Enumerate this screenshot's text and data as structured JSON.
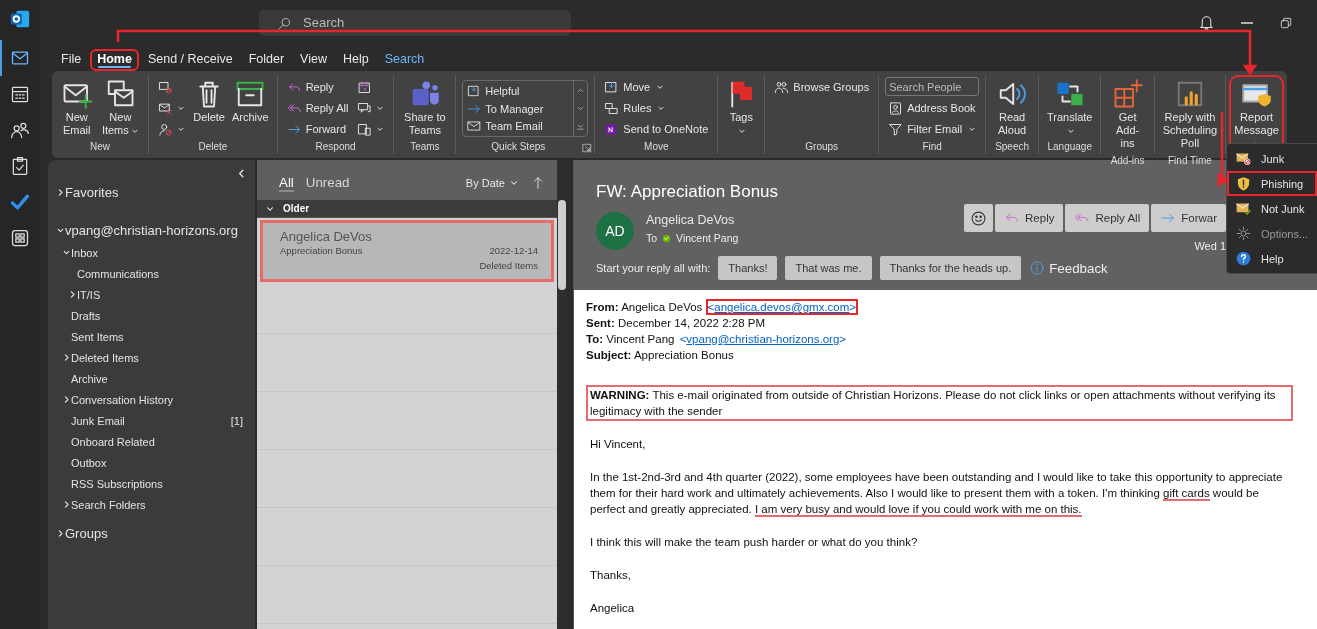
{
  "app_bar": {
    "items": [
      {
        "selected": true
      },
      {
        "selected": false
      },
      {
        "selected": false
      },
      {
        "selected": false
      },
      {
        "selected": false
      },
      {
        "selected": false
      }
    ]
  },
  "search": {
    "placeholder": "Search"
  },
  "menu_tabs": [
    {
      "label": "File",
      "kind": "standard",
      "selected": false,
      "highlighted": false
    },
    {
      "label": "Home",
      "kind": "standard",
      "selected": true,
      "highlighted": true
    },
    {
      "label": "Send / Receive",
      "kind": "standard",
      "selected": false,
      "highlighted": false
    },
    {
      "label": "Folder",
      "kind": "standard",
      "selected": false,
      "highlighted": false
    },
    {
      "label": "View",
      "kind": "standard",
      "selected": false,
      "highlighted": false
    },
    {
      "label": "Help",
      "kind": "standard",
      "selected": false,
      "highlighted": false
    },
    {
      "label": "Search",
      "kind": "contextual",
      "selected": false,
      "highlighted": false
    }
  ],
  "ribbon": {
    "groups": [
      {
        "label": "New",
        "highlighted": false,
        "columns": [
          [
            {
              "kind": "large",
              "label": "New Email"
            }
          ],
          [
            {
              "kind": "large",
              "label": "New Items",
              "dropdown": true
            }
          ]
        ]
      },
      {
        "label": "Delete",
        "highlighted": false,
        "columns": [
          [
            {
              "kind": "icon"
            },
            {
              "kind": "icon",
              "dropdown": true
            },
            {
              "kind": "icon",
              "dropdown": true
            }
          ],
          [
            {
              "kind": "large",
              "label": "Delete"
            }
          ],
          [
            {
              "kind": "large",
              "label": "Archive"
            }
          ]
        ]
      },
      {
        "label": "Respond",
        "highlighted": false,
        "columns": [
          [
            {
              "kind": "small",
              "label": "Reply"
            },
            {
              "kind": "small",
              "label": "Reply All"
            },
            {
              "kind": "small",
              "label": "Forward"
            }
          ],
          [
            {
              "kind": "icon"
            },
            {
              "kind": "icon",
              "dropdown": true
            },
            {
              "kind": "icon",
              "dropdown": true
            }
          ]
        ]
      },
      {
        "label": "Teams",
        "highlighted": false,
        "columns": [
          [
            {
              "kind": "large",
              "label": "Share to Teams"
            }
          ]
        ]
      },
      {
        "label": "Quick Steps",
        "highlighted": false,
        "launcher": true,
        "columns": [
          [
            {
              "kind": "gallery",
              "items": [
                "Helpful",
                "To Manager",
                "Team Email"
              ]
            }
          ]
        ]
      },
      {
        "label": "Move",
        "highlighted": false,
        "columns": [
          [
            {
              "kind": "small",
              "label": "Move",
              "dropdown": true
            },
            {
              "kind": "small",
              "label": "Rules",
              "dropdown": true
            },
            {
              "kind": "small",
              "label": "Send to OneNote"
            }
          ]
        ]
      },
      {
        "highlighted": false,
        "columns": [
          [
            {
              "kind": "large",
              "label": "Tags",
              "dropdown": true
            }
          ]
        ]
      },
      {
        "label": "Groups",
        "highlighted": false,
        "columns": [
          [
            {
              "kind": "small",
              "label": "Browse Groups"
            }
          ]
        ]
      },
      {
        "label": "Find",
        "highlighted": false,
        "columns": [
          [
            {
              "kind": "field",
              "placeholder": "Search People"
            },
            {
              "kind": "small",
              "label": "Address Book"
            },
            {
              "kind": "small",
              "label": "Filter Email",
              "dropdown": true
            }
          ]
        ]
      },
      {
        "label": "Speech",
        "highlighted": false,
        "columns": [
          [
            {
              "kind": "large",
              "label": "Read Aloud"
            }
          ]
        ]
      },
      {
        "label": "Language",
        "highlighted": false,
        "columns": [
          [
            {
              "kind": "large",
              "label": "Translate",
              "dropdown": true
            }
          ]
        ]
      },
      {
        "label": "Add-ins",
        "highlighted": false,
        "columns": [
          [
            {
              "kind": "large",
              "label": "Get Add-ins"
            }
          ]
        ]
      },
      {
        "label": "Find Time",
        "highlighted": false,
        "columns": [
          [
            {
              "kind": "large",
              "label": "Reply with Scheduling Poll"
            }
          ]
        ]
      },
      {
        "highlighted": true,
        "columns": [
          [
            {
              "kind": "large",
              "label": "Report Message",
              "dropdown": true
            }
          ]
        ]
      }
    ]
  },
  "folders": [
    {
      "label": "Favorites",
      "expanded": false
    },
    {
      "label": "vpang@christian-horizons.org",
      "expanded": true,
      "children": [
        {
          "label": "Inbox",
          "expanded": true,
          "children": [
            {
              "label": "Communications"
            },
            {
              "label": "IT/IS",
              "expanded": false
            }
          ]
        },
        {
          "label": "Drafts"
        },
        {
          "label": "Sent Items"
        },
        {
          "label": "Deleted Items",
          "expanded": false
        },
        {
          "label": "Archive"
        },
        {
          "label": "Conversation History",
          "expanded": false
        },
        {
          "label": "Junk Email",
          "count": "[1]"
        },
        {
          "label": "Onboard Related"
        },
        {
          "label": "Outbox"
        },
        {
          "label": "RSS Subscriptions"
        },
        {
          "label": "Search Folders",
          "expanded": false
        }
      ]
    },
    {
      "label": "Groups",
      "expanded": false
    }
  ],
  "message_list": {
    "filters": [
      {
        "label": "All",
        "selected": true
      },
      {
        "label": "Unread",
        "selected": false
      }
    ],
    "sort": "By Date",
    "group_header": "Older",
    "messages": [
      {
        "sender": "Angelica DeVos",
        "subject": "Appreciation Bonus",
        "date": "2022-12-14",
        "folder": "Deleted Items",
        "selected": true,
        "highlighted": true
      }
    ]
  },
  "reading_pane": {
    "subject": "FW: Appreciation Bonus",
    "avatar_initials": "AD",
    "sender": "Angelica DeVos",
    "to_label": "To",
    "recipient": "Vincent Pang",
    "date": "Wed 1",
    "actions": [
      "Reply",
      "Reply All",
      "Forwar"
    ],
    "quick_reply_label": "Start your reply all with:",
    "quick_replies": [
      "Thanks!",
      "That was me.",
      "Thanks for the heads up."
    ],
    "feedback": "Feedback",
    "headers": [
      {
        "label": "From:",
        "value": "Angelica DeVos",
        "address": [
          "<",
          "angelica.devos@gmx.com",
          ">"
        ],
        "highlighted": true
      },
      {
        "label": "Sent:",
        "value": "December 14, 2022 2:28 PM"
      },
      {
        "label": "To:",
        "value": "Vincent Pang",
        "address": [
          "<",
          "vpang@christian-horizons.org",
          ">"
        ],
        "highlighted": false
      },
      {
        "label": "Subject:",
        "value": "Appreciation Bonus"
      }
    ],
    "paragraphs": [
      {
        "kind": "rich",
        "text": "**WARNING:** This e-mail originated from outside of Christian Horizons. Please do not click links or open attachments without verifying its legitimacy with the sender",
        "highlighted": true
      },
      {
        "kind": "rich",
        "text": "Hi Vincent,",
        "highlighted": false
      },
      {
        "kind": "segments",
        "highlighted": false,
        "segments": [
          {
            "text": "In the 1st-2nd-3rd and 4th quarter (2022), some employees have been outstanding and I would like to take this opportunity to appreciate them for their hard work and ultimately achievements. Also I would like to present them with a token. I'm thinking ",
            "underlined": false
          },
          {
            "text": "gift cards",
            "underlined": true
          },
          {
            "text": " would be perfect and greatly appreciated. ",
            "underlined": false
          },
          {
            "text": "I am very busy and would love if you could work with me on this.",
            "underlined": true
          }
        ]
      },
      {
        "kind": "rich",
        "text": "I think this will make the team push harder or what do you think?",
        "highlighted": false
      },
      {
        "kind": "rich",
        "text": "Thanks,",
        "highlighted": false
      },
      {
        "kind": "rich",
        "text": "Angelica",
        "highlighted": false
      }
    ]
  },
  "report_menu": {
    "items": [
      {
        "label": "Junk",
        "highlighted": false
      },
      {
        "label": "Phishing",
        "highlighted": true
      },
      {
        "label": "Not Junk",
        "highlighted": false
      },
      {
        "label": "Options...",
        "highlighted": false
      },
      {
        "label": "Help",
        "highlighted": false
      }
    ]
  }
}
